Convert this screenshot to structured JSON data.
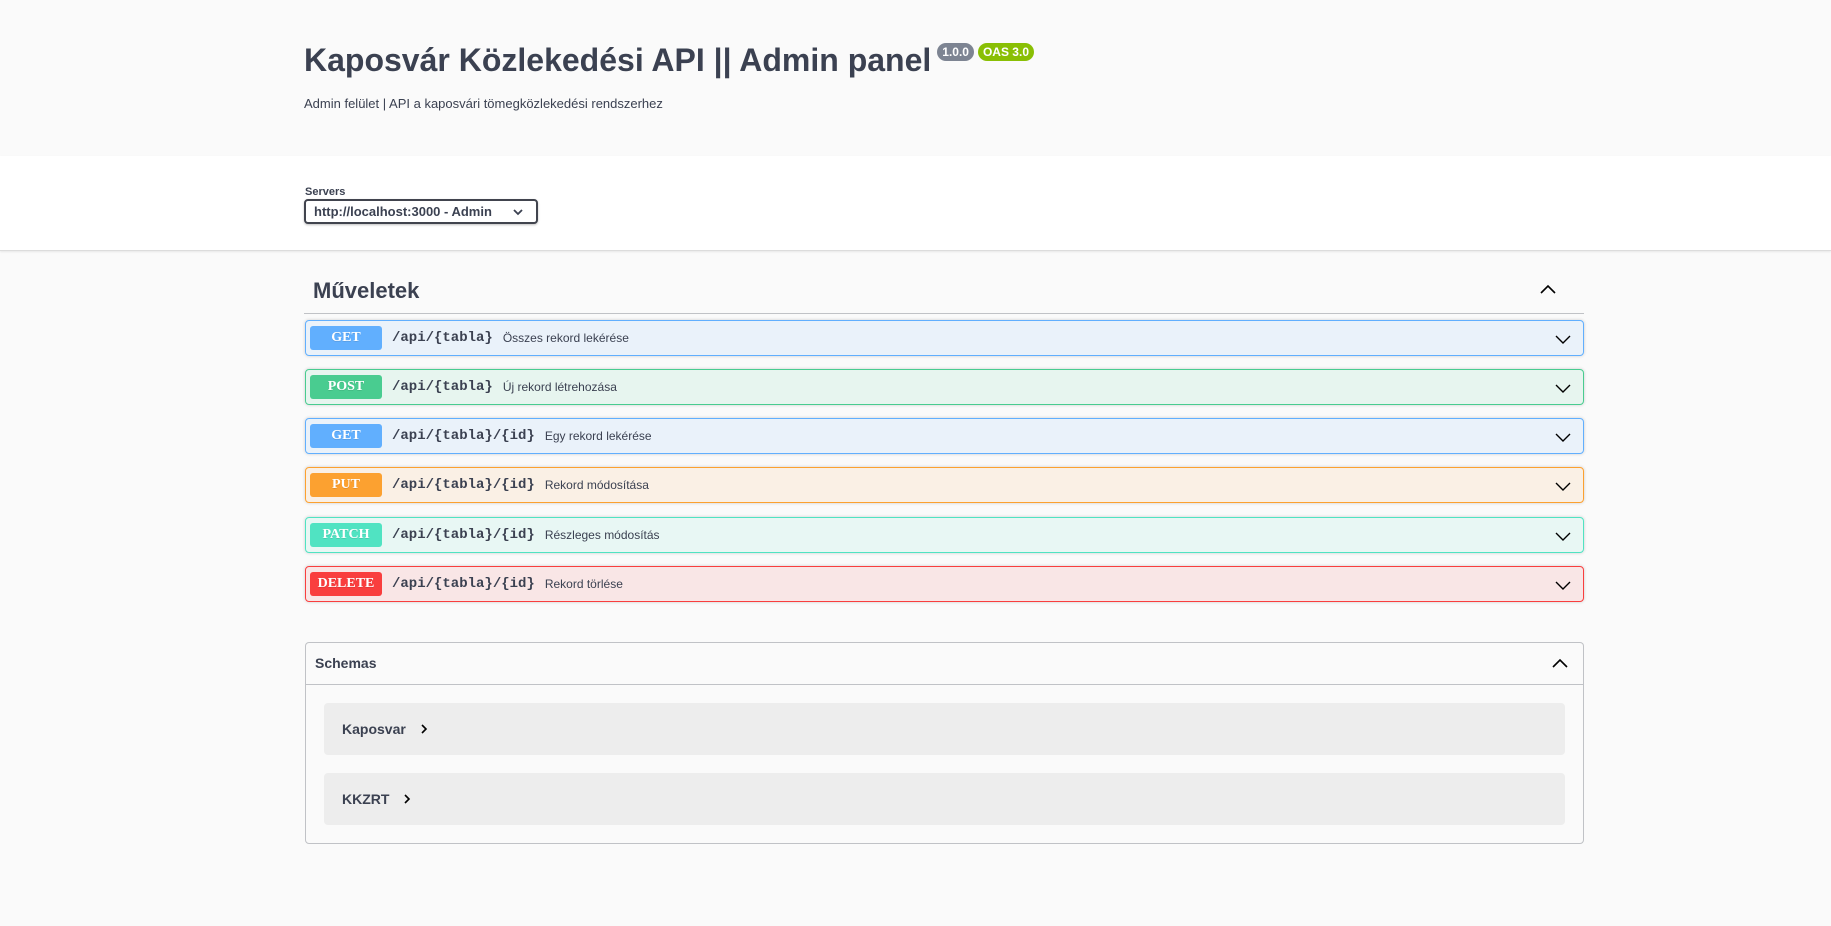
{
  "info": {
    "title": "Kaposvár Közlekedési API || Admin panel",
    "version_badge": "1.0.0",
    "oas_badge": "OAS 3.0",
    "description": "Admin felület | API a kaposvári tömegközlekedési rendszerhez"
  },
  "servers": {
    "label": "Servers",
    "selected": "http://localhost:3000 - Admin"
  },
  "operations_section": {
    "title": "Műveletek",
    "expanded": true,
    "operations": [
      {
        "method": "GET",
        "path": "/api/{tabla}",
        "summary": "Összes rekord lekérése"
      },
      {
        "method": "POST",
        "path": "/api/{tabla}",
        "summary": "Új rekord létrehozása"
      },
      {
        "method": "GET",
        "path": "/api/{tabla}/{id}",
        "summary": "Egy rekord lekérése"
      },
      {
        "method": "PUT",
        "path": "/api/{tabla}/{id}",
        "summary": "Rekord módosítása"
      },
      {
        "method": "PATCH",
        "path": "/api/{tabla}/{id}",
        "summary": "Részleges módosítás"
      },
      {
        "method": "DELETE",
        "path": "/api/{tabla}/{id}",
        "summary": "Rekord törlése"
      }
    ]
  },
  "schemas": {
    "title": "Schemas",
    "expanded": true,
    "models": [
      {
        "name": "Kaposvar"
      },
      {
        "name": "KKZRT"
      }
    ]
  },
  "colors": {
    "get": "#61affe",
    "post": "#49cc90",
    "put": "#fca130",
    "patch": "#50e3c2",
    "delete": "#f93e3e",
    "text": "#3b4151"
  }
}
